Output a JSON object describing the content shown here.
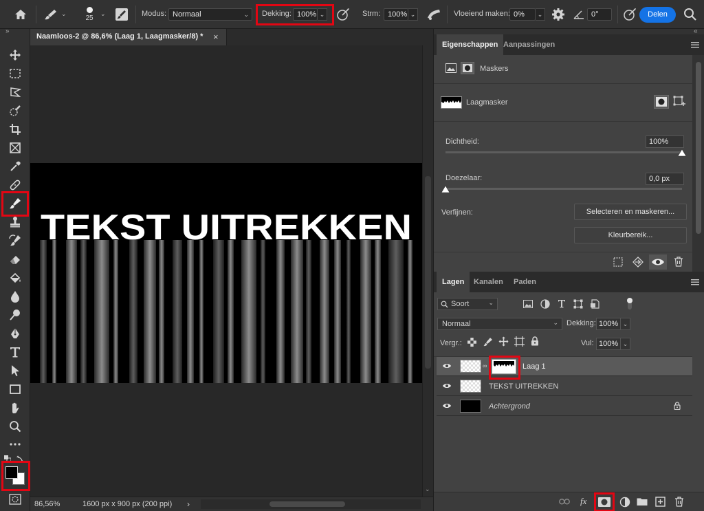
{
  "options_bar": {
    "brush_size": "25",
    "mode_label": "Modus:",
    "mode_value": "Normaal",
    "opacity_label": "Dekking:",
    "opacity_value": "100%",
    "flow_label": "Strm:",
    "flow_value": "100%",
    "smoothing_label": "Vloeiend maken:",
    "smoothing_value": "0%",
    "angle_value": "0°",
    "share_label": "Delen"
  },
  "document": {
    "tab_title": "Naamloos-2 @ 86,6% (Laag 1, Laagmasker/8) *",
    "canvas_text": "TEKST UITREKKEN",
    "zoom": "86,56%",
    "dimensions": "1600 px x 900 px (200 ppi)",
    "status_arrow": "›"
  },
  "properties_panel": {
    "tabs": [
      "Eigenschappen",
      "Aanpassingen"
    ],
    "masks_label": "Maskers",
    "layer_mask_label": "Laagmasker",
    "density_label": "Dichtheid:",
    "density_value": "100%",
    "density_fraction": 1.0,
    "feather_label": "Doezelaar:",
    "feather_value": "0,0 px",
    "feather_fraction": 0.0,
    "refine_label": "Verfijnen:",
    "select_mask_button": "Selecteren en maskeren...",
    "color_range_button": "Kleurbereik..."
  },
  "layers_panel": {
    "tabs": [
      "Lagen",
      "Kanalen",
      "Paden"
    ],
    "filter_label": "Soort",
    "blend_mode": "Normaal",
    "opacity_label": "Dekking:",
    "opacity_value": "100%",
    "lock_label": "Vergr.:",
    "fill_label": "Vul:",
    "fill_value": "100%",
    "layers": [
      {
        "name": "Laag 1",
        "selected": true,
        "italic": false
      },
      {
        "name": "TEKST UITREKKEN",
        "selected": false,
        "italic": false
      },
      {
        "name": "Achtergrond",
        "selected": false,
        "italic": true
      }
    ],
    "fx_label": "fx"
  },
  "colors": {
    "accent": "#1473e6",
    "highlight_box": "#e30613",
    "foreground": "#000000",
    "background": "#ffffff"
  }
}
